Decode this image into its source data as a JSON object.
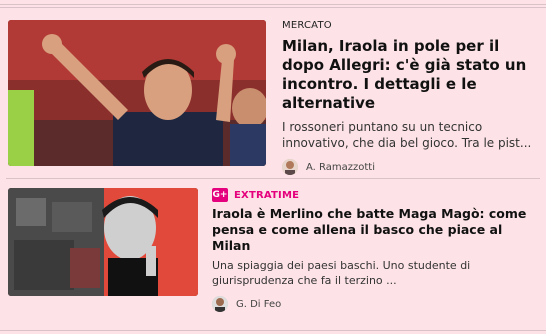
{
  "articles": [
    {
      "category": "MERCATO",
      "title": "Milan, Iraola in pole per il dopo Allegri: c'è già stato un incontro. I dettagli e le alternative",
      "summary": "I rossoneri puntano su un tecnico innovativo, che dia bel gioco. Tra le pist...",
      "author": "A. Ramazzotti"
    },
    {
      "badge": "G+",
      "category": "EXTRATIME",
      "title": "Iraola è Merlino che batte Maga Magò: come pensa e come allena il basco che piace al Milan",
      "summary": "Una spiaggia dei paesi baschi. Uno studente di giurisprudenza che fa il terzino ...",
      "author": "G. Di Feo"
    }
  ],
  "colors": {
    "background": "#fde3e7",
    "accent": "#e5007d"
  }
}
